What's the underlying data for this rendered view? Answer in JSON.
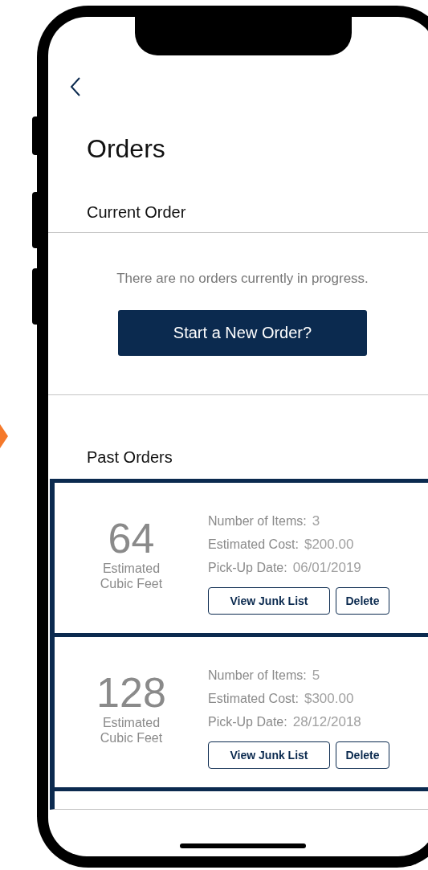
{
  "screen": {
    "title": "Orders",
    "current_order": {
      "heading": "Current Order",
      "message": "There are no orders currently in progress.",
      "button": "Start a New Order?"
    },
    "past_orders": {
      "heading": "Past Orders",
      "orders": [
        {
          "volume": "64",
          "volume_label": "Estimated Cubic Feet",
          "fields": [
            {
              "label": "Number of Items:",
              "value": "3"
            },
            {
              "label": "Estimated Cost:",
              "value": "$200.00"
            },
            {
              "label": "Pick-Up Date:",
              "value": "06/01/2019"
            }
          ],
          "buttons": [
            "View Junk List",
            "Delete"
          ]
        },
        {
          "volume": "128",
          "volume_label": "Estimated Cubic Feet",
          "fields": [
            {
              "label": "Number of Items:",
              "value": "5"
            },
            {
              "label": "Estimated Cost:",
              "value": "$300.00"
            },
            {
              "label": "Pick-Up Date:",
              "value": "28/12/2018"
            }
          ],
          "buttons": [
            "View Junk List",
            "Delete"
          ]
        }
      ]
    }
  }
}
